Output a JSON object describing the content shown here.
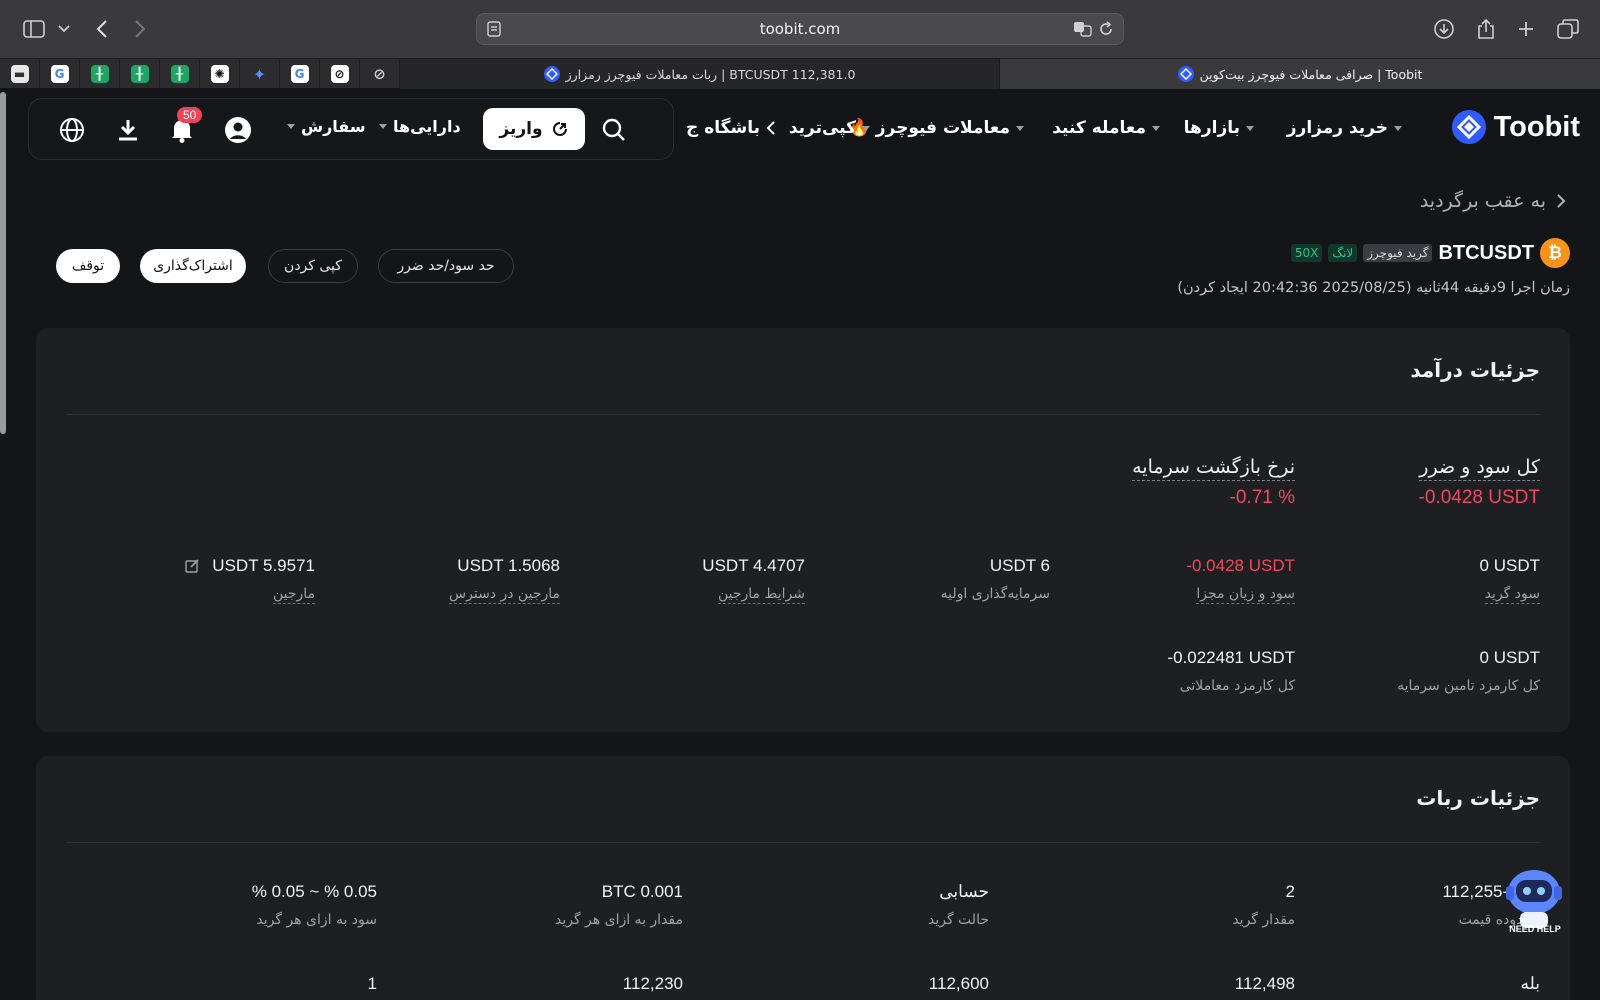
{
  "browser": {
    "url": "toobit.com",
    "tabs": [
      {
        "title": "ربات معاملات فیوچرز رمزارز | BTCUSDT 112,381.0",
        "active": false
      },
      {
        "title": "صرافی معاملات فیوچرز بیت‌کوین | Toobit",
        "active": true
      }
    ],
    "pinned_tabs": [
      "mail",
      "google",
      "sheets",
      "sheets",
      "sheets",
      "openai",
      "gemini",
      "google",
      "perplexity",
      "compass"
    ]
  },
  "site": {
    "logo_text": "Toobit",
    "nav": {
      "buy_crypto": "خرید رمزارز",
      "markets": "بازارها",
      "trade": "معامله کنید",
      "futures": "معاملات فیوچرز",
      "copy_trade": "کپی‌ترید",
      "club": "باشگاه ج",
      "orders": "سفارش",
      "assets": "دارایی‌ها",
      "deposit": "واریز",
      "notification_count": "50"
    }
  },
  "page": {
    "back_label": "به عقب برگردید",
    "pair": "BTCUSDT",
    "tag_type": "گرید فیوچرز",
    "tag_side": "لانگ",
    "tag_leverage": "50X",
    "runtime": "زمان اجرا 9دقیقه 44ثانیه (2025/08/25 20:42:36 ایجاد کردن)",
    "buttons": {
      "tp_sl": "حد سود/حد ضرر",
      "copy": "کپی کردن",
      "share": "اشتراک‌گذاری",
      "stop": "توقف"
    }
  },
  "income": {
    "title": "جزئیات درآمد",
    "total_pnl_label": "کل سود و ضرر",
    "total_pnl_value": "-0.0428 USDT",
    "roi_label": "نرخ بازگشت سرمایه",
    "roi_value": "-0.71 %",
    "cells": [
      {
        "label": "سود گرید",
        "value": "0 USDT"
      },
      {
        "label": "سود و زیان مجزا",
        "value": "-0.0428 USDT"
      },
      {
        "label": "سرمایه‌گذاری اولیه",
        "value": "USDT 6"
      },
      {
        "label": "شرایط مارجین",
        "value": "USDT 4.4707"
      },
      {
        "label": "مارجین در دسترس",
        "value": "USDT 1.5068"
      },
      {
        "label": "مارجین",
        "value": "USDT 5.9571"
      }
    ],
    "fees": [
      {
        "label": "کل کارمزد تامین سرمایه",
        "value": "0 USDT"
      },
      {
        "label": "کل کارمزد معاملاتی",
        "value": "-0.022481 USDT"
      }
    ]
  },
  "robot": {
    "title": "جزئیات ربات",
    "cells": [
      {
        "label": "محدوده قیمت",
        "value": "112,255-112,"
      },
      {
        "label": "مقدار گرید",
        "value": "2"
      },
      {
        "label": "حالت گرید",
        "value": "حسابی"
      },
      {
        "label": "مقدار به ازای هر گرید",
        "value": "BTC 0.001"
      },
      {
        "label": "سود به ازای هر گرید",
        "value": "% 0.05 ~ % 0.05"
      }
    ],
    "row2": [
      "بله",
      "112,498",
      "112,600",
      "112,230",
      "1"
    ],
    "helper_label": "NEED HELP"
  },
  "colors": {
    "negative": "#f2475b",
    "brand": "#2f5bff",
    "positive_tag": "#2fc38a"
  }
}
